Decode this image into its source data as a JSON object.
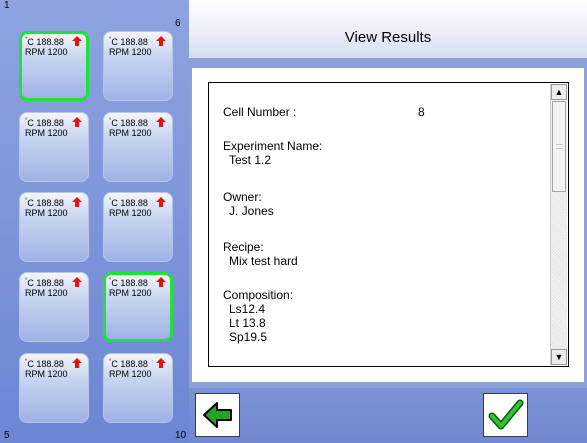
{
  "grid": {
    "corner_labels": {
      "top_left": "1",
      "top_right": "6",
      "bottom_left": "5",
      "bottom_right": "10"
    },
    "cells": [
      {
        "temp": "188.88",
        "rpm": "RPM 1200",
        "selected": true
      },
      {
        "temp": "188.88",
        "rpm": "RPM 1200",
        "selected": false
      },
      {
        "temp": "188.88",
        "rpm": "RPM 1200",
        "selected": false
      },
      {
        "temp": "188.88",
        "rpm": "RPM 1200",
        "selected": false
      },
      {
        "temp": "188.88",
        "rpm": "RPM 1200",
        "selected": false
      },
      {
        "temp": "188.88",
        "rpm": "RPM 1200",
        "selected": false
      },
      {
        "temp": "188.88",
        "rpm": "RPM 1200",
        "selected": false
      },
      {
        "temp": "188.88",
        "rpm": "RPM 1200",
        "selected": false
      },
      {
        "temp": "188.88",
        "rpm": "RPM 1200",
        "selected": true
      },
      {
        "temp": "188.88",
        "rpm": "RPM 1200",
        "selected": false
      }
    ],
    "temp_unit": "°C",
    "arrow_icon": "up-arrow-icon",
    "arrow_color": "#e0140f",
    "selected_border_color": "#1ee23a"
  },
  "header": {
    "title": "View Results"
  },
  "details": {
    "cell_number_label": "Cell Number :",
    "cell_number_value": "8",
    "experiment_label": "Experiment Name:",
    "experiment_value": "Test 1.2",
    "owner_label": "Owner:",
    "owner_value": "J. Jones",
    "recipe_label": "Recipe:",
    "recipe_value": "Mix test hard",
    "composition_label": "Composition:",
    "composition_values": [
      "Ls12.4",
      "Lt 13.8",
      "Sp19.5"
    ]
  },
  "scrollbar": {
    "up_glyph": "▲",
    "down_glyph": "▼"
  },
  "footer": {
    "back_icon": "back-arrow-icon",
    "confirm_icon": "checkmark-icon",
    "accent_green": "#1fa81f"
  }
}
